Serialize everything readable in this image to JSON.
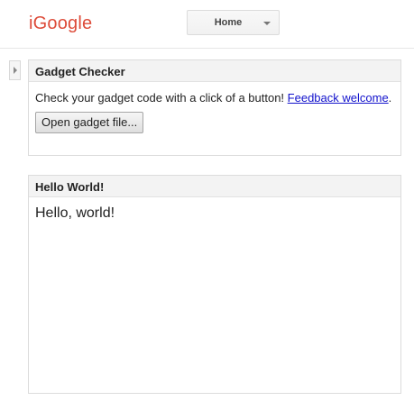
{
  "header": {
    "logo": "iGoogle",
    "tab_selector": {
      "label": "Home"
    }
  },
  "gadgets": [
    {
      "title": "Gadget Checker",
      "body_text": "Check your gadget code with a click of a button!",
      "link_text": "Feedback welcome",
      "link_suffix": ".",
      "button_label": "Open gadget file..."
    },
    {
      "title": "Hello World!",
      "body_text": "Hello, world!"
    }
  ],
  "colors": {
    "logo": "#dd4b39",
    "link": "#1111cc",
    "gadget_header_bg": "#f3f3f3",
    "border": "#dcdcdc"
  }
}
